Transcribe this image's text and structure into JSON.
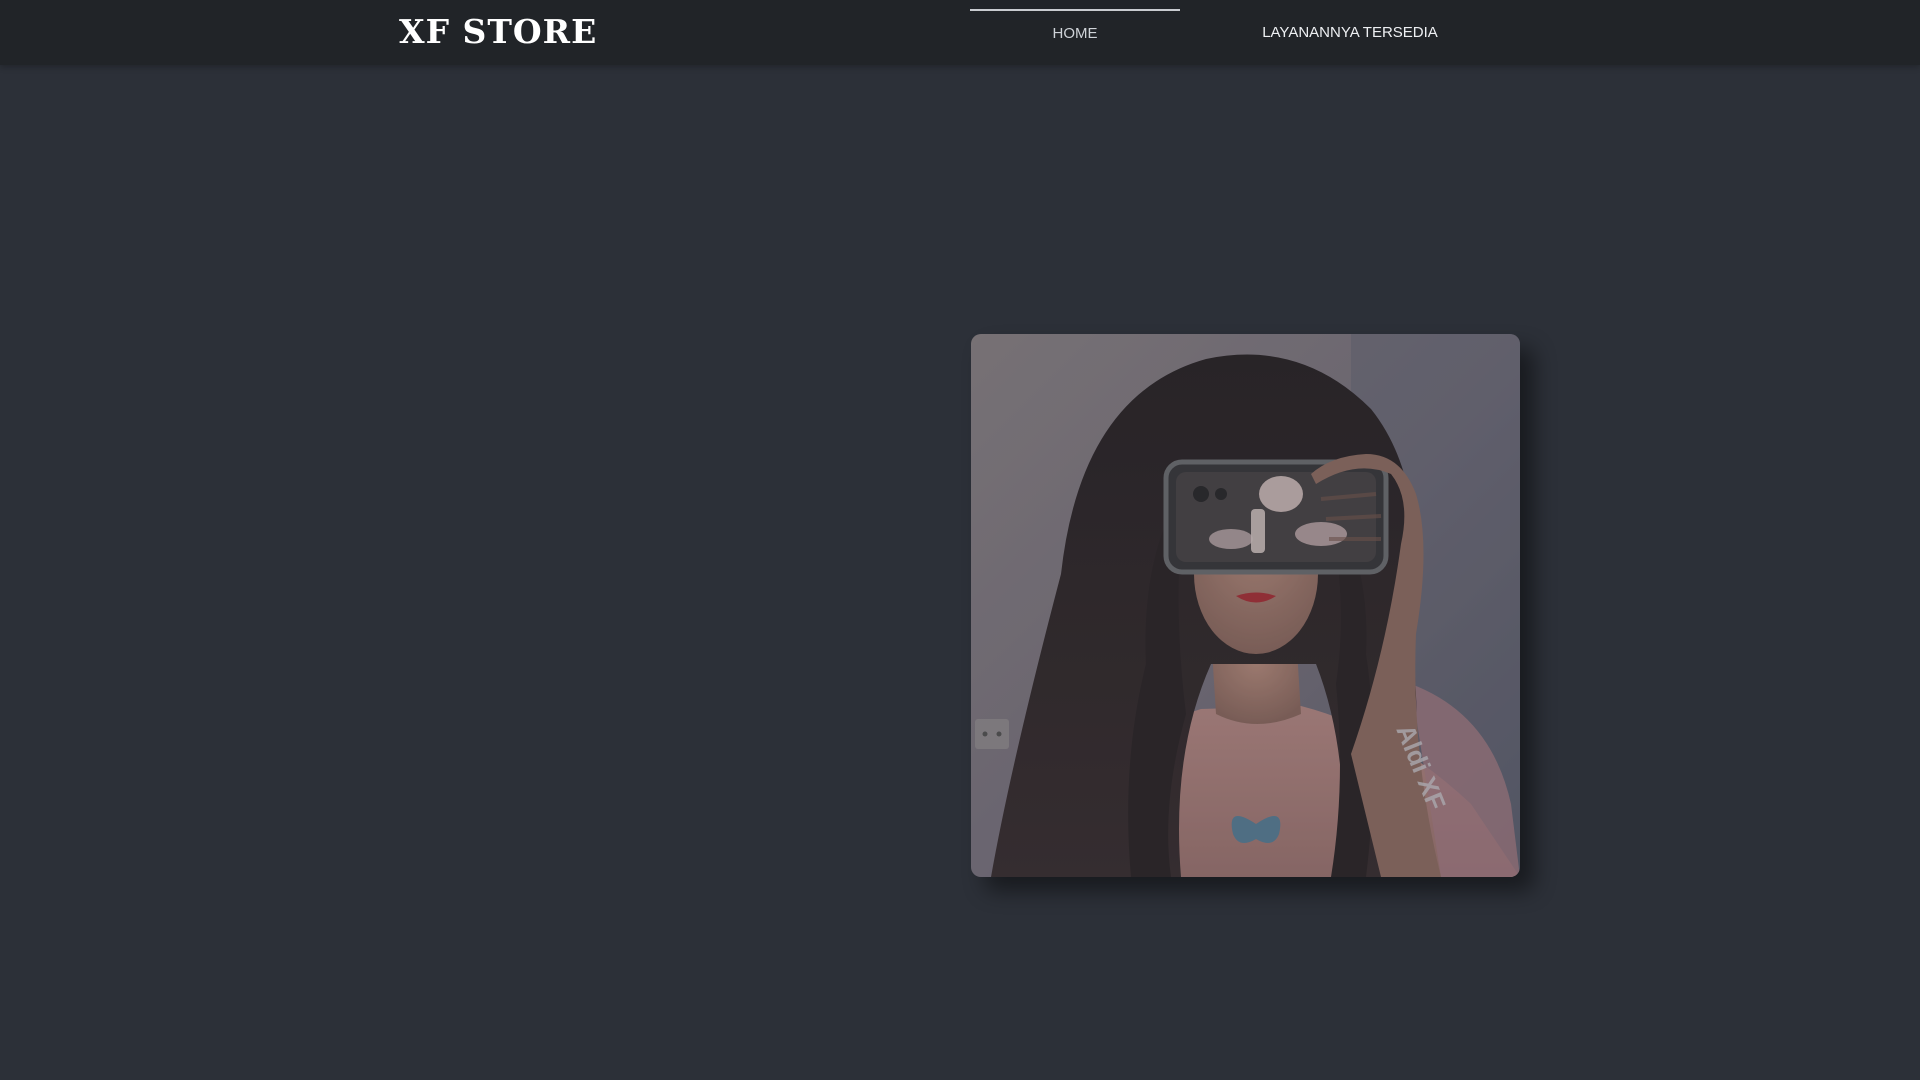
{
  "navbar": {
    "brand": "XF STORE",
    "links": [
      {
        "label": "HOME",
        "active": true
      },
      {
        "label": "LAYANANNYA TERSEDIA",
        "active": false
      }
    ]
  },
  "hero": {
    "photo": {
      "subject": "selfie-photo",
      "watermark": "Aldi XF"
    }
  },
  "colors": {
    "background": "#2c3038",
    "navbar": "#212428",
    "text": "#ffffff"
  }
}
